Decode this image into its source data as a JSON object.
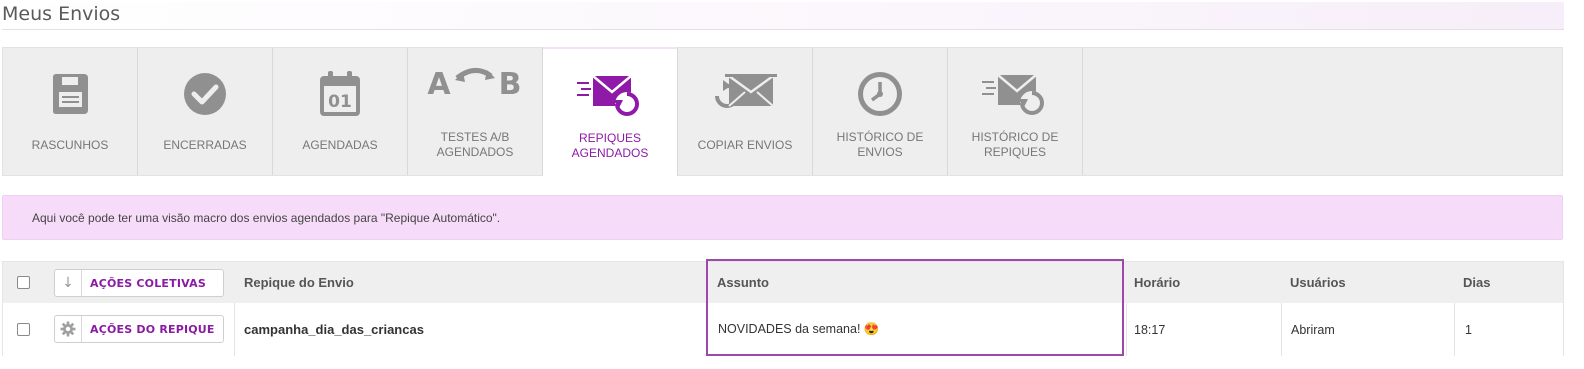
{
  "page": {
    "title": "Meus Envios"
  },
  "tabs": [
    {
      "label": "RASCUNHOS",
      "icon": "floppy-disk-icon"
    },
    {
      "label": "ENCERRADAS",
      "icon": "check-circle-icon"
    },
    {
      "label": "AGENDADAS",
      "icon": "calendar-icon",
      "day": "01"
    },
    {
      "label": "TESTES A/B\nAGENDADOS",
      "icon": "ab-test-icon",
      "a": "A",
      "b": "B"
    },
    {
      "label": "REPIQUES\nAGENDADOS",
      "icon": "scheduled-repique-icon",
      "active": true
    },
    {
      "label": "COPIAR ENVIOS",
      "icon": "copy-send-icon"
    },
    {
      "label": "HISTÓRICO DE\nENVIOS",
      "icon": "clock-icon"
    },
    {
      "label": "HISTÓRICO DE\nREPIQUES",
      "icon": "repique-history-icon"
    }
  ],
  "info": {
    "text": "Aqui você pode ter uma visão macro dos envios agendados para \"Repique Automático\"."
  },
  "table": {
    "header": {
      "bulk_actions": "AÇÕES COLETIVAS",
      "col_envio": "Repique do Envio",
      "col_assunto": "Assunto",
      "col_horario": "Horário",
      "col_usuarios": "Usuários",
      "col_dias": "Dias"
    },
    "rows": [
      {
        "actions": "AÇÕES DO REPIQUE",
        "envio": "campanha_dia_das_criancas",
        "assunto": "NOVIDADES da semana! 😍",
        "horario": "18:17",
        "usuarios": "Abriram",
        "dias": "1"
      }
    ]
  },
  "colors": {
    "accent": "#8f1aa8",
    "info_bg": "#f6dcf9",
    "highlight": "#9b4aa9"
  }
}
